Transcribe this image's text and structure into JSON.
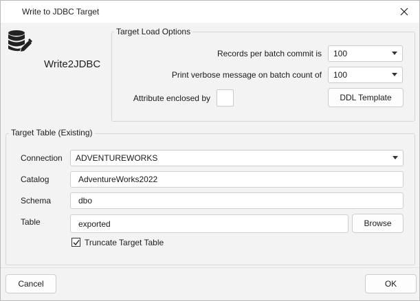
{
  "window": {
    "title": "Write to JDBC Target",
    "app_name": "Write2JDBC"
  },
  "load_options": {
    "title": "Target Load Options",
    "records_label": "Records per batch commit is",
    "records_value": "100",
    "verbose_label": "Print verbose message on batch count of",
    "verbose_value": "100",
    "attribute_label": "Attribute enclosed by",
    "attribute_value": "",
    "ddl_button": "DDL Template"
  },
  "target_table": {
    "title": "Target Table (Existing)",
    "connection_label": "Connection",
    "connection_value": "ADVENTUREWORKS",
    "catalog_label": "Catalog",
    "catalog_value": "AdventureWorks2022",
    "schema_label": "Schema",
    "schema_value": "dbo",
    "table_label": "Table",
    "table_value": "exported",
    "browse_button": "Browse",
    "truncate_label": "Truncate Target Table",
    "truncate_checked": true
  },
  "footer": {
    "cancel": "Cancel",
    "ok": "OK"
  },
  "icons": {
    "app": "database-edit-icon",
    "close": "close-icon",
    "dropdown": "chevron-down-icon",
    "check": "checkmark-icon"
  }
}
